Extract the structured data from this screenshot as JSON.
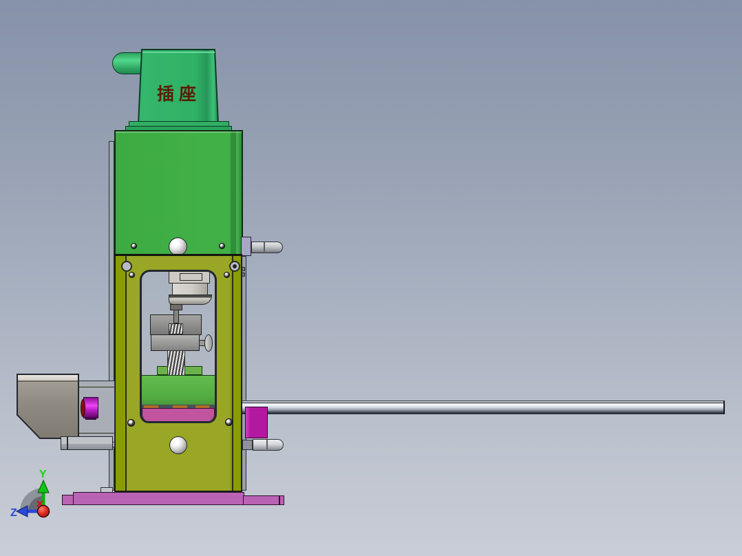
{
  "viewport": {
    "background_top": "#8692a9",
    "background_bottom": "#c9cdd7"
  },
  "model": {
    "hopper_label": "插座",
    "parts": [
      {
        "name": "hopper-spout",
        "color": "#37b56b"
      },
      {
        "name": "hopper-body",
        "color": "#2fb169"
      },
      {
        "name": "machine-body",
        "color": "#3fae44"
      },
      {
        "name": "press-frame",
        "color": "#97a41f"
      },
      {
        "name": "piston",
        "color": "#ccc9c3"
      },
      {
        "name": "die-blocks",
        "color": "#9a9a98"
      },
      {
        "name": "feed-block",
        "color": "#5ab648"
      },
      {
        "name": "slide-block",
        "color": "#c2539e"
      },
      {
        "name": "ejector-block",
        "color": "#b318a1"
      },
      {
        "name": "motor-roller",
        "color": "#cb2ed3"
      },
      {
        "name": "motor-housing",
        "color": "#8f8b83"
      },
      {
        "name": "guide-rod",
        "color": "#aeb6c2"
      },
      {
        "name": "base-plate",
        "color": "#b963b4"
      }
    ]
  },
  "triad": {
    "y_label": "Y",
    "z_label": "Z",
    "y_color": "#14c614",
    "z_color": "#2b49d6",
    "origin_color": "#c41111"
  }
}
